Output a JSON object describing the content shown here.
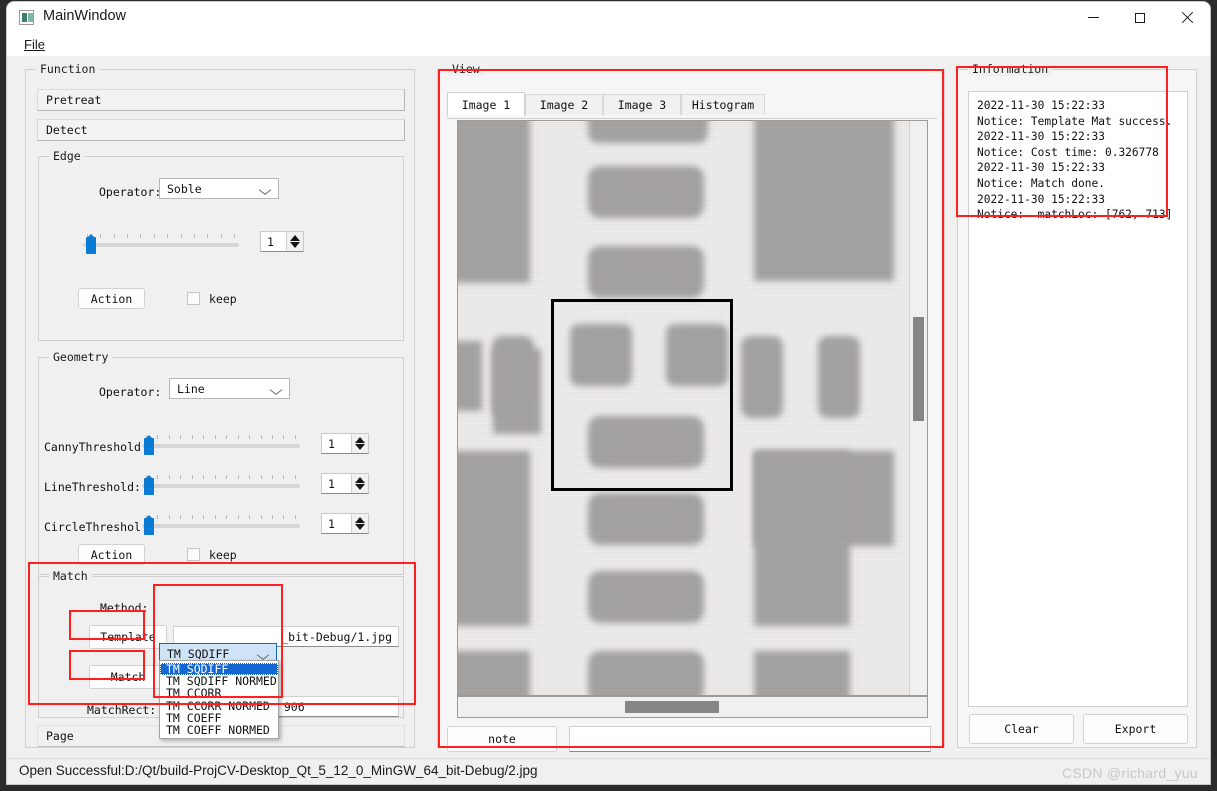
{
  "window": {
    "title": "MainWindow",
    "icon": "app-icon",
    "minimize": "minimize-icon",
    "maximize": "maximize-icon",
    "close": "close-icon"
  },
  "menubar": {
    "items": [
      {
        "label": "File",
        "mnemonic": "F"
      }
    ]
  },
  "function_group": {
    "title": "Function",
    "buttons": [
      {
        "label": "Pretreat"
      },
      {
        "label": "Detect"
      }
    ]
  },
  "edge_group": {
    "title": "Edge",
    "operator_label": "Operator:",
    "operator_value": "Soble",
    "operator_options": [
      "Soble"
    ],
    "slider_value": 1,
    "spin_value": "1",
    "action_label": "Action",
    "keep_label": "keep",
    "keep_checked": false
  },
  "geometry_group": {
    "title": "Geometry",
    "operator_label": "Operator:",
    "operator_value": "Line",
    "operator_options": [
      "Line"
    ],
    "rows": [
      {
        "label": "CannyThreshold",
        "value": "1"
      },
      {
        "label": "LineThreshold:",
        "value": "1"
      },
      {
        "label": "CircleThreshol",
        "value": "1"
      }
    ],
    "action_label": "Action",
    "keep_label": "keep",
    "keep_checked": false
  },
  "match_group": {
    "title": "Match",
    "method_label": "Method:",
    "method_value": "TM SQDIFF",
    "method_options": [
      "TM SQDIFF",
      "TM SQDIFF NORMED",
      "TM CCORR",
      "TM CCORR NORMED",
      "TM COEFF",
      "TM COEFF NORMED"
    ],
    "method_selected_index": 0,
    "template_button": "Template",
    "match_button": "Match",
    "template_path": "_bit-Debug/1.jpg",
    "matchrect_label": "MatchRect:",
    "matchrect_value": "762, 713, 944, 906"
  },
  "page_field": {
    "label": "Page"
  },
  "view_group": {
    "title": "View",
    "tabs": [
      {
        "label": "Image 1",
        "active": true
      },
      {
        "label": "Image 2",
        "active": false
      },
      {
        "label": "Image 3",
        "active": false
      },
      {
        "label": "Histogram",
        "active": false
      }
    ],
    "note_button": "note",
    "note_value": ""
  },
  "information_group": {
    "title": "Information",
    "log_lines": [
      "2022-11-30 15:22:33",
      "Notice: Template Mat success.",
      "2022-11-30 15:22:33",
      "Notice: Cost time: 0.326778",
      "2022-11-30 15:22:33",
      "Notice: Match done.",
      "2022-11-30 15:22:33",
      "Notice:  matchLoc: [762, 713]"
    ],
    "clear_button": "Clear",
    "export_button": "Export"
  },
  "statusbar": {
    "message": "Open Successful:D:/Qt/build-ProjCV-Desktop_Qt_5_12_0_MinGW_64_bit-Debug/2.jpg",
    "watermark": "CSDN @richard_yuu"
  },
  "colors": {
    "accent": "#0a7bd4",
    "selection": "#1267d2",
    "annotation": "#ff1f1f",
    "window_bg": "#f0f0f0",
    "panel_bg": "#ffffff"
  }
}
